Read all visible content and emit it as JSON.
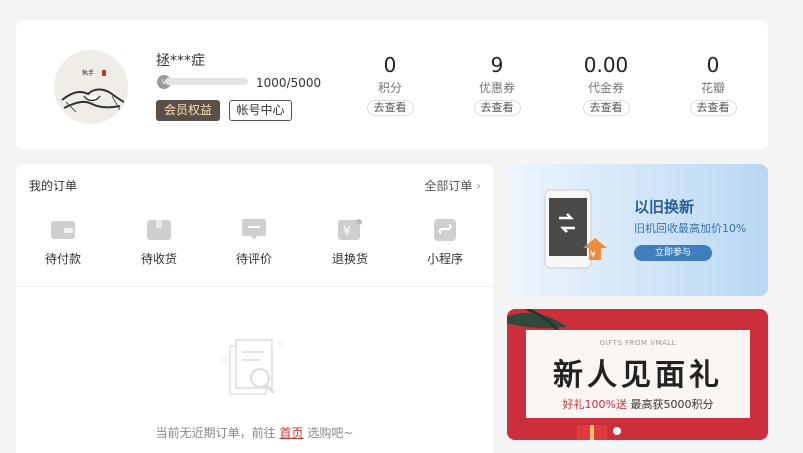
{
  "profile": {
    "username": "拯***症",
    "level_badge": "V",
    "progress_fraction": 0.0,
    "progress_text": "1000/5000",
    "member_button": "会员权益",
    "account_button": "帐号中心",
    "stats": [
      {
        "value": "0",
        "label": "积分",
        "action": "去查看"
      },
      {
        "value": "9",
        "label": "优惠券",
        "action": "去查看"
      },
      {
        "value": "0.00",
        "label": "代金券",
        "action": "去查看"
      },
      {
        "value": "0",
        "label": "花瓣",
        "action": "去查看"
      }
    ]
  },
  "orders": {
    "title": "我的订单",
    "all_link": "全部订单",
    "items": [
      {
        "label": "待付款",
        "icon": "wallet-icon"
      },
      {
        "label": "待收货",
        "icon": "box-icon"
      },
      {
        "label": "待评价",
        "icon": "comment-icon"
      },
      {
        "label": "退换货",
        "icon": "return-icon"
      },
      {
        "label": "小程序",
        "icon": "miniprogram-icon"
      }
    ],
    "empty_prefix": "当前无近期订单，前往",
    "empty_link": "首页",
    "empty_suffix": "选购吧~"
  },
  "promo_trade_in": {
    "title": "以旧换新",
    "subtitle": "旧机回收最高加价10%",
    "button": "立即参与"
  },
  "promo_gift": {
    "top_line": "GIFTS FROM VMALL",
    "headline": "新人见面礼",
    "sub_red": "好礼100%送",
    "sub_rest": "最高获5000积分"
  },
  "colors": {
    "member_button_bg": "#5a5047",
    "gift_bg": "#cc2f3b",
    "trade_in_accent": "#3f7dbd"
  }
}
